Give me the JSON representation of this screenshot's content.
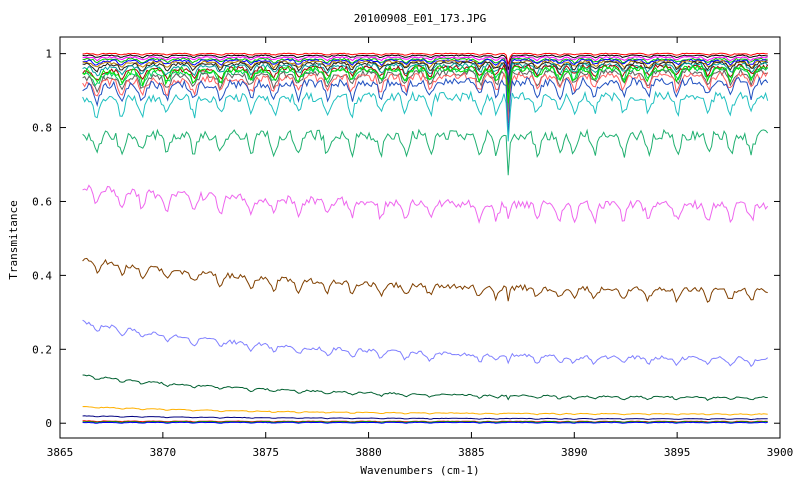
{
  "chart_data": {
    "type": "line",
    "title": "20100908_E01_173.JPG",
    "xlabel": "Wavenumbers (cm-1)",
    "ylabel": "Transmitance",
    "xlim": [
      3865,
      3900
    ],
    "ylim": [
      -0.04,
      1.045
    ],
    "x_ticks": [
      "3865",
      "3870",
      "3875",
      "3880",
      "3885",
      "3890",
      "3895",
      "3900"
    ],
    "y_ticks": [
      "0",
      "0.2",
      "0.4",
      "0.6",
      "0.8",
      "1"
    ],
    "grid": false,
    "x_range_of_data": [
      3866.1,
      3899.4
    ],
    "series": [
      {
        "color": "#ff0000",
        "level_start": 1.0,
        "level_end": 1.0,
        "depth": 0.004,
        "deep_line": 0.03
      },
      {
        "color": "#000000",
        "level_start": 0.995,
        "level_end": 0.995,
        "depth": 0.006,
        "deep_line": 0.04
      },
      {
        "color": "#ff00ff",
        "level_start": 0.99,
        "level_end": 0.99,
        "depth": 0.008,
        "deep_line": 0.05
      },
      {
        "color": "#00c000",
        "level_start": 0.985,
        "level_end": 0.985,
        "depth": 0.01,
        "deep_line": 0.06
      },
      {
        "color": "#0000ff",
        "level_start": 0.98,
        "level_end": 0.982,
        "depth": 0.012,
        "deep_line": 0.07
      },
      {
        "color": "#c08000",
        "level_start": 0.975,
        "level_end": 0.978,
        "depth": 0.015,
        "deep_line": 0.08
      },
      {
        "color": "#202020",
        "level_start": 0.97,
        "level_end": 0.975,
        "depth": 0.018,
        "deep_line": 0.09
      },
      {
        "color": "#00a0a0",
        "level_start": 0.96,
        "level_end": 0.97,
        "depth": 0.022,
        "deep_line": 0.1
      },
      {
        "color": "#a00000",
        "level_start": 0.95,
        "level_end": 0.965,
        "depth": 0.026,
        "deep_line": 0.11
      },
      {
        "color": "#00d060",
        "level_start": 0.94,
        "level_end": 0.96,
        "depth": 0.03,
        "deep_line": 0.12
      },
      {
        "color": "#606060",
        "level_start": 0.93,
        "level_end": 0.95,
        "depth": 0.034,
        "deep_line": 0.13
      },
      {
        "color": "#ff6060",
        "level_start": 0.92,
        "level_end": 0.94,
        "depth": 0.04,
        "deep_line": 0.14
      },
      {
        "color": "#00e000",
        "level_start": 0.95,
        "level_end": 0.96,
        "depth": 0.035,
        "deep_line": 0.1
      },
      {
        "color": "#2050c0",
        "level_start": 0.91,
        "level_end": 0.925,
        "depth": 0.045,
        "deep_line": 0.15
      },
      {
        "color": "#20c0c0",
        "level_start": 0.875,
        "level_end": 0.885,
        "depth": 0.05,
        "deep_line": 0.12
      },
      {
        "color": "#20b070",
        "level_start": 0.78,
        "level_end": 0.78,
        "depth": 0.055,
        "deep_line": 0.1
      },
      {
        "color": "#ee66ee",
        "level_start": 0.635,
        "level_end": 0.59,
        "depth": 0.045,
        "deep_line": 0.05
      },
      {
        "color": "#804000",
        "level_start": 0.445,
        "level_end": 0.36,
        "depth": 0.03,
        "deep_line": 0.04
      },
      {
        "color": "#8080ff",
        "level_start": 0.275,
        "level_end": 0.175,
        "depth": 0.02,
        "deep_line": 0.02
      },
      {
        "color": "#006030",
        "level_start": 0.13,
        "level_end": 0.07,
        "depth": 0.008,
        "deep_line": 0.01
      },
      {
        "color": "#ffb000",
        "level_start": 0.045,
        "level_end": 0.025,
        "depth": 0.003,
        "deep_line": 0.0
      },
      {
        "color": "#000080",
        "level_start": 0.02,
        "level_end": 0.012,
        "depth": 0.002,
        "deep_line": 0.0
      },
      {
        "color": "#ff0000",
        "level_start": 0.006,
        "level_end": 0.005,
        "depth": 0.002,
        "deep_line": 0.0
      },
      {
        "color": "#00a000",
        "level_start": 0.004,
        "level_end": 0.004,
        "depth": 0.002,
        "deep_line": 0.0
      },
      {
        "color": "#0000ff",
        "level_start": 0.002,
        "level_end": 0.002,
        "depth": 0.002,
        "deep_line": 0.0
      }
    ]
  }
}
